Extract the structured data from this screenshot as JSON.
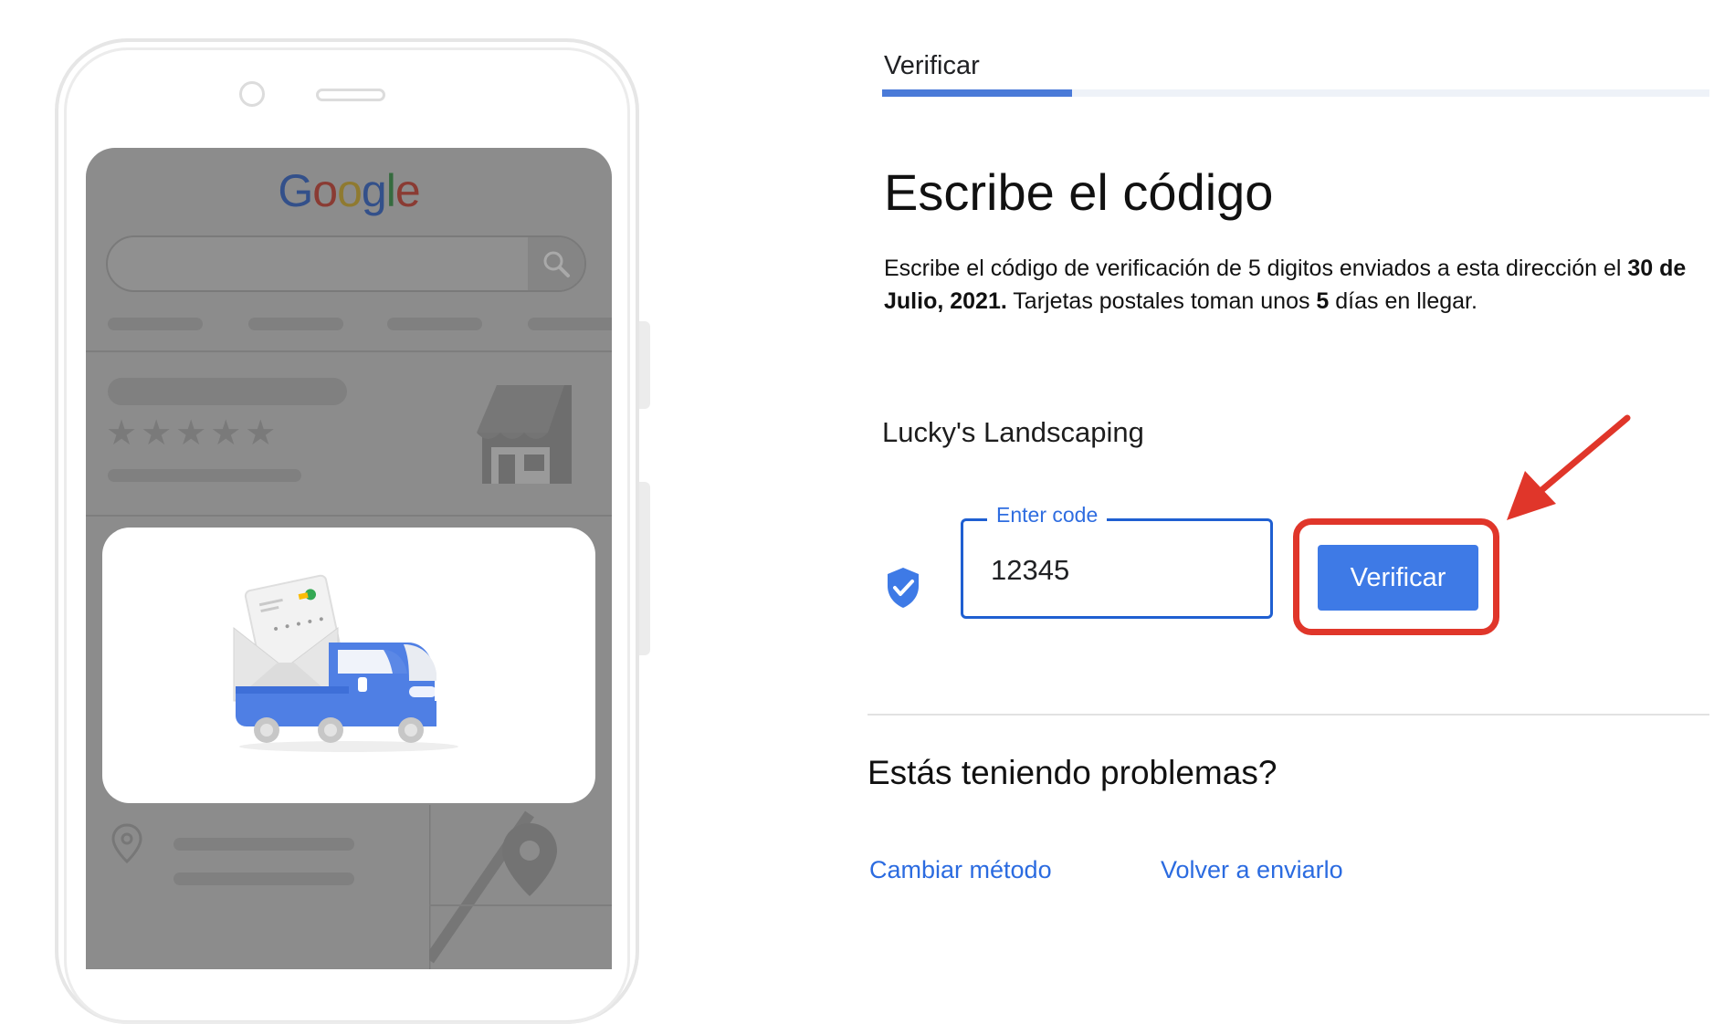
{
  "phone": {
    "google_logo": [
      "G",
      "o",
      "o",
      "g",
      "l",
      "e"
    ],
    "logo_colors": [
      "#33508a",
      "#8a3b33",
      "#8f7a30",
      "#33508a",
      "#356b3e",
      "#8a3b33"
    ],
    "rating_stars": "★★★★★"
  },
  "tab": {
    "label": "Verificar",
    "progress_percent": 23
  },
  "main": {
    "title": "Escribe el código",
    "desc_part1": "Escribe el código de verificación de 5 digitos enviados a esta dirección el ",
    "desc_date": "30 de Julio, 2021.",
    "desc_part2": " Tarjetas postales toman unos ",
    "desc_days": "5",
    "desc_part3": " días en llegar.",
    "business_name": "Lucky's Landscaping"
  },
  "code_field": {
    "label": "Enter code",
    "value": "12345"
  },
  "verify_button": {
    "label": "Verificar"
  },
  "help": {
    "title": "Estás teniendo problemas?",
    "link_change": "Cambiar método",
    "link_resend": "Volver a enviarlo"
  },
  "colors": {
    "accent": "#3e7ae6",
    "highlight": "#e0362a",
    "link": "#2b6be0"
  }
}
